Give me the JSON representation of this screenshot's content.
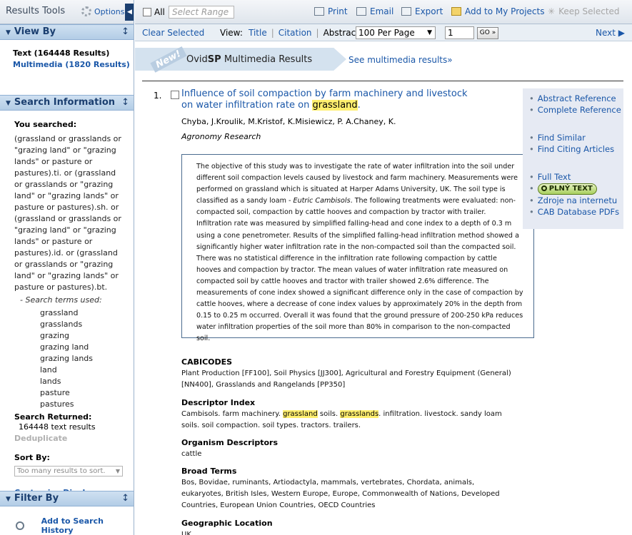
{
  "sidebar": {
    "tools_title": "Results Tools",
    "options_label": "Options",
    "collapse_label": "◀",
    "view_by": {
      "title": "View By",
      "text_results": "Text (164448 Results)",
      "multimedia_results": "Multimedia (1820 Results)"
    },
    "search_info": {
      "title": "Search Information",
      "you_searched_label": "You searched:",
      "query": "(grassland or grasslands or \"grazing land\" or \"grazing lands\" or pasture or pastures).ti. or (grassland or grasslands or \"grazing land\" or \"grazing lands\" or pasture or pastures).sh. or (grassland or grasslands or \"grazing land\" or \"grazing lands\" or pasture or pastures).id. or (grassland or grasslands or \"grazing land\" or \"grazing lands\" or pasture or pastures).bt.",
      "terms_label": "- Search terms used:",
      "terms": [
        "grassland",
        "grasslands",
        "grazing",
        "grazing land",
        "grazing lands",
        "land",
        "lands",
        "pasture",
        "pastures"
      ],
      "returned_label": "Search Returned:",
      "returned_value": "164448 text results",
      "deduplicate_label": "Deduplicate",
      "sort_by_label": "Sort By:",
      "sort_value": "Too many results to sort.",
      "customize_label": "Customize Display"
    },
    "filter_by": {
      "title": "Filter By",
      "add_history_label": "Add to Search History"
    }
  },
  "toolbar": {
    "all_label": "All",
    "range_placeholder": "Select Range",
    "print_label": "Print",
    "email_label": "Email",
    "export_label": "Export",
    "projects_label": "Add to My Projects",
    "keep_label": "Keep Selected"
  },
  "subbar": {
    "clear_label": "Clear Selected",
    "view_label": "View:",
    "view_options": [
      "Title",
      "Citation",
      "Abstract"
    ],
    "per_page": "100 Per Page",
    "page_number": "1",
    "go_label": "GO »",
    "next_label": "Next ▶"
  },
  "banner": {
    "new_badge": "New!",
    "title_prefix": "Ovid",
    "title_bold": "SP",
    "title_suffix": " Multimedia Results",
    "link_label": "See multimedia results»"
  },
  "result": {
    "number": "1.",
    "title_part1": "Influence of soil compaction by farm machinery and livestock on water infiltration rate on ",
    "title_highlight": "grassland",
    "title_part2": ".",
    "authors": "Chyba, J.Kroulik, M.Kristof, K.Misiewicz, P. A.Chaney, K.",
    "journal": "Agronomy Research",
    "abstract_part1": "The objective of this study was to investigate the rate of water infiltration into the soil under different soil compaction levels caused by livestock and farm machinery. Measurements were performed on grassland which is situated at Harper Adams University, UK. The soil type is classified as a sandy loam - ",
    "abstract_italic": "Eutric Cambisols",
    "abstract_part2": ". The following treatments were evaluated: non-compacted soil, compaction by cattle hooves and compaction by tractor with trailer. Infiltration rate was measured by simplified falling-head and cone index to a depth of 0.3 m using a cone penetrometer. Results of the simplified falling-head infiltration method showed a significantly higher water infiltration rate in the non-compacted soil than the compacted soil. There was no statistical difference in the infiltration rate following compaction by cattle hooves and compaction by tractor. The mean values of water infiltration rate measured on compacted soil by cattle hooves and tractor with trailer showed 2.6% difference. The measurements of cone index showed a significant difference only in the case of compaction by cattle hooves, where a decrease of cone index values by approximately 20% in the depth from 0.15 to 0.25 m occurred. Overall it was found that the ground pressure of 200-250 kPa reduces water infiltration properties of the soil more than 80% in comparison to the non-compacted soil.",
    "side_links": {
      "abstract_ref": "Abstract Reference",
      "complete_ref": "Complete Reference",
      "find_similar": "Find Similar",
      "find_citing": "Find Citing Articles",
      "full_text": "Full Text",
      "plny_text": "PLNÝ TEXT",
      "zdroje": "Zdroje na internetu",
      "cab_pdfs": "CAB Database PDFs"
    },
    "cabicodes_label": "CABICODES",
    "cabicodes_value": "Plant Production [FF100], Soil Physics [JJ300], Agricultural and Forestry Equipment (General) [NN400], Grasslands and Rangelands [PP350]",
    "descriptor_label": "Descriptor Index",
    "descriptor_part1": "Cambisols. farm machinery. ",
    "descriptor_hl1": "grassland",
    "descriptor_part2": " soils. ",
    "descriptor_hl2": "grasslands",
    "descriptor_part3": ". infiltration. livestock. sandy loam soils. soil compaction. soil types. tractors. trailers.",
    "organism_label": "Organism Descriptors",
    "organism_value": "cattle",
    "broad_label": "Broad Terms",
    "broad_value": "Bos, Bovidae, ruminants, Artiodactyla, mammals, vertebrates, Chordata, animals, eukaryotes, British Isles, Western Europe, Europe, Commonwealth of Nations, Developed Countries, European Union Countries, OECD Countries",
    "geo_label": "Geographic Location",
    "geo_value": "UK"
  }
}
